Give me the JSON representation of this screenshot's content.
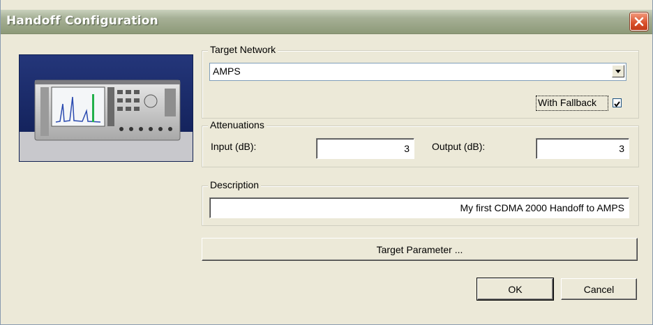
{
  "window": {
    "title": "Handoff Configuration"
  },
  "target_network": {
    "group_label": "Target Network",
    "selected": "AMPS",
    "fallback_label": "With Fallback",
    "fallback_checked": true
  },
  "attenuations": {
    "group_label": "Attenuations",
    "input_label": "Input (dB):",
    "input_value": "3",
    "output_label": "Output (dB):",
    "output_value": "3"
  },
  "description": {
    "group_label": "Description",
    "value": "My first CDMA 2000 Handoff to AMPS"
  },
  "buttons": {
    "target_parameter": "Target Parameter ...",
    "ok": "OK",
    "cancel": "Cancel"
  }
}
